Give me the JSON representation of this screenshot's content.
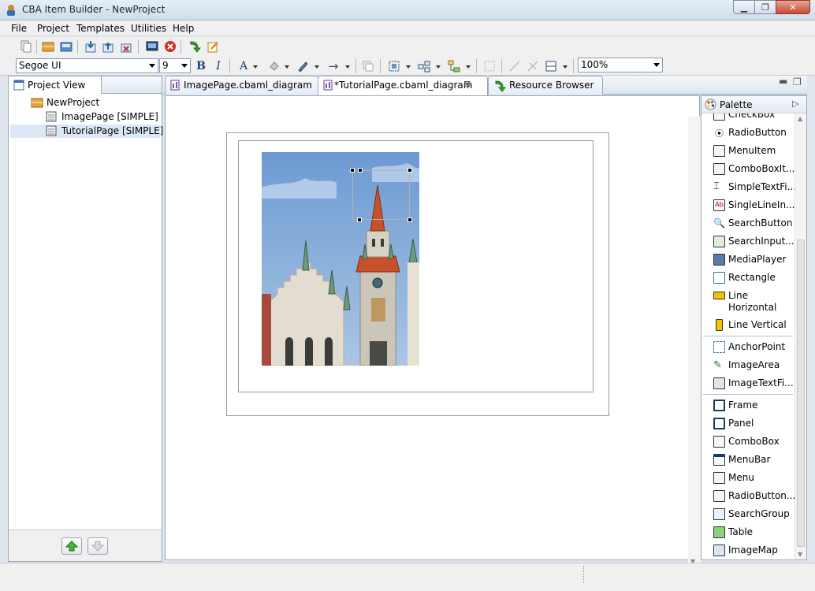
{
  "window": {
    "title": "CBA Item Builder - NewProject"
  },
  "menu": [
    "File",
    "Project",
    "Templates",
    "Utilities",
    "Help"
  ],
  "format": {
    "font": "Segoe UI",
    "size": "9",
    "bold": "B",
    "italic": "I",
    "font_color": "A",
    "zoom": "100%"
  },
  "project_view": {
    "tab_label": "Project View",
    "root": "NewProject",
    "items": [
      "ImagePage [SIMPLE]",
      "TutorialPage [SIMPLE]"
    ]
  },
  "editor": {
    "tabs": [
      "ImagePage.cbaml_diagram",
      "*TutorialPage.cbaml_diagram",
      "Resource Browser"
    ]
  },
  "palette": {
    "title": "Palette",
    "group1": [
      "CheckBox",
      "RadioButton",
      "MenuItem",
      "ComboBoxIt...",
      "SimpleTextFi...",
      "SingleLineIn...",
      "SearchButton",
      "SearchInput...",
      "MediaPlayer",
      "Rectangle",
      "Line Horizontal",
      "Line Vertical"
    ],
    "group2": [
      "AnchorPoint",
      "ImageArea",
      "ImageTextFi..."
    ],
    "group3": [
      "Frame",
      "Panel",
      "ComboBox",
      "MenuBar",
      "Menu",
      "RadioButton...",
      "SearchGroup",
      "Table",
      "ImageMap"
    ]
  }
}
